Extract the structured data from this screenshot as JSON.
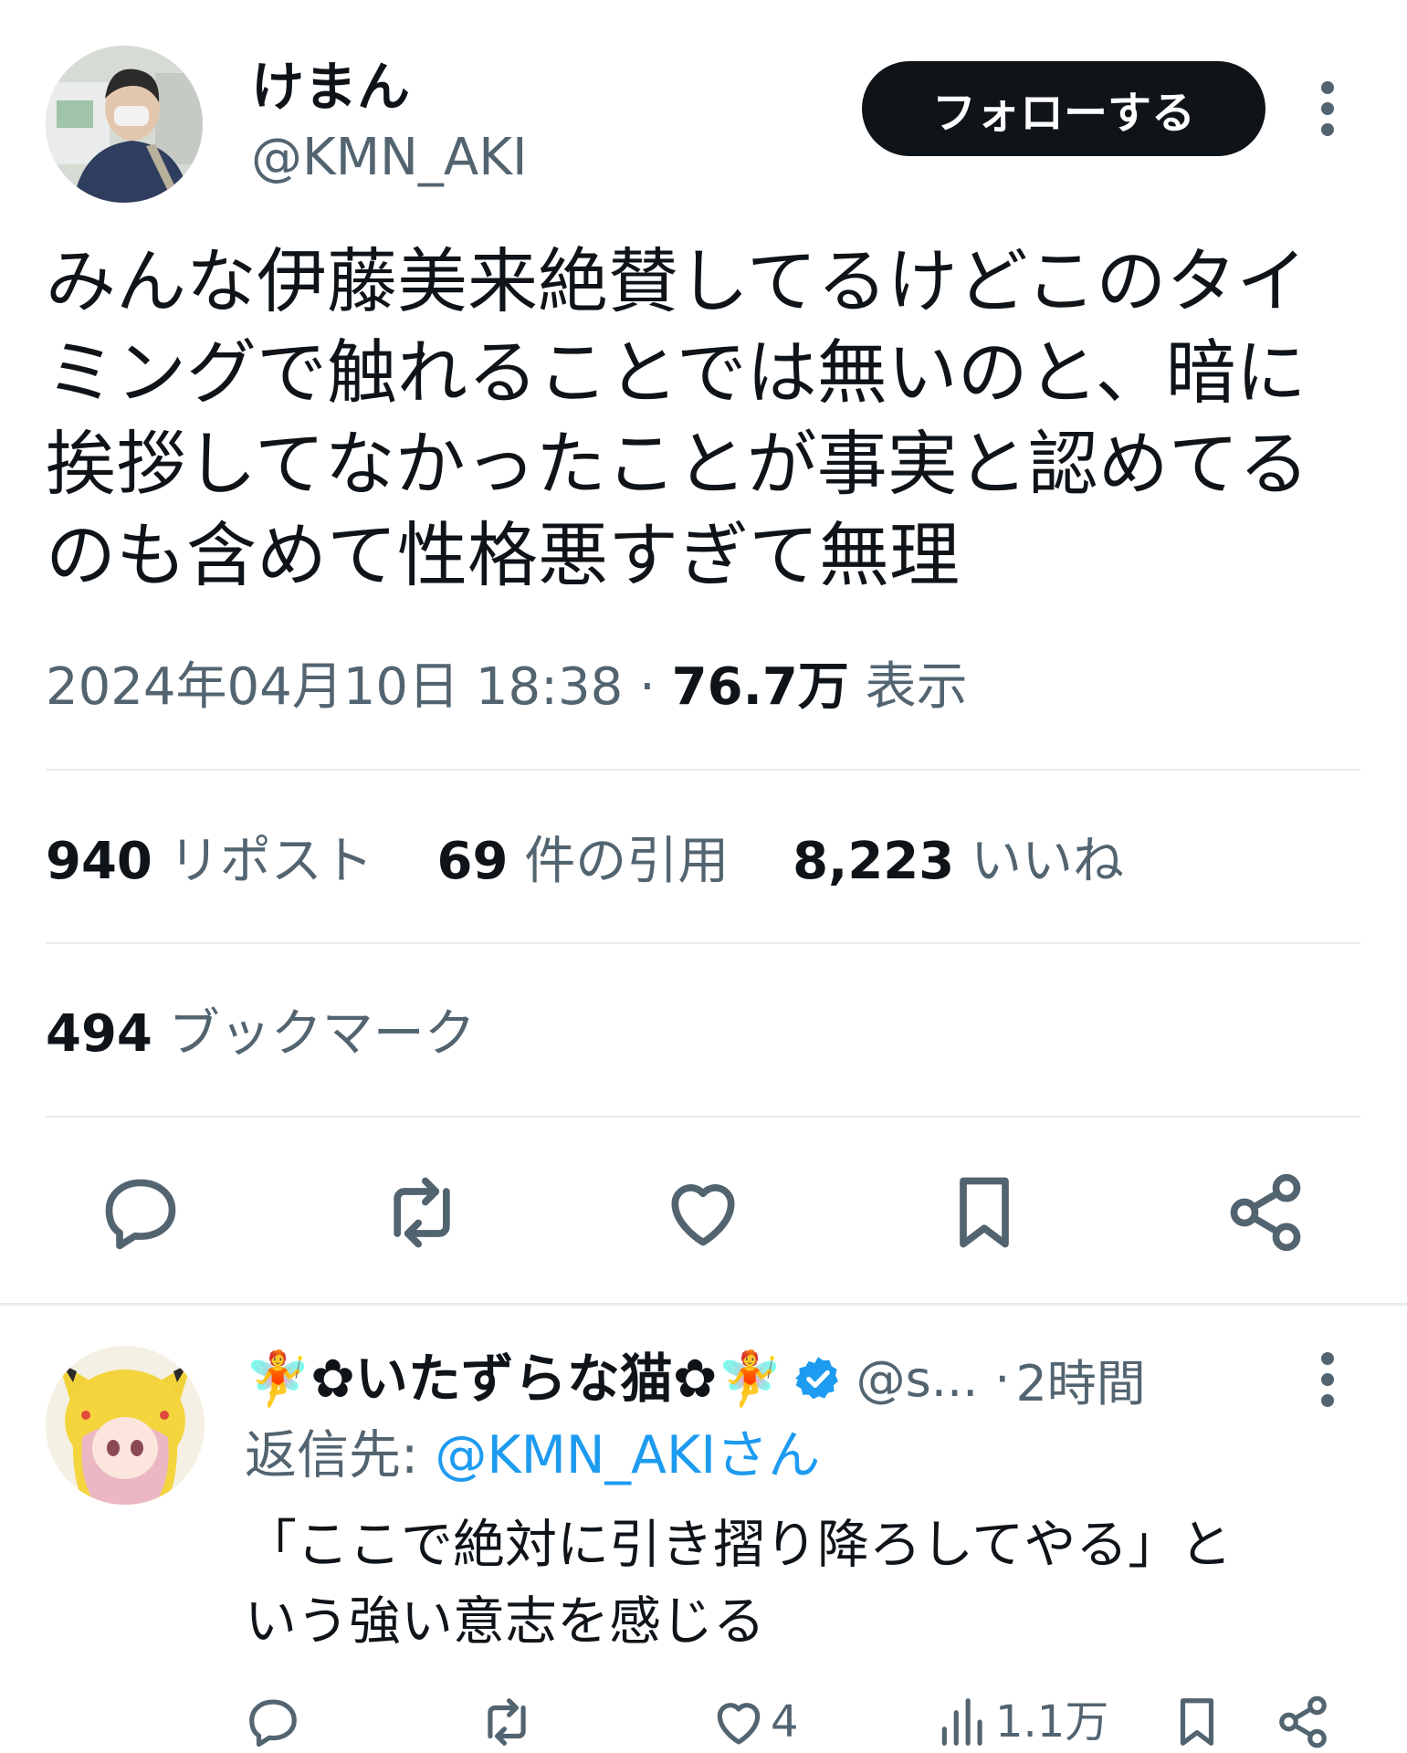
{
  "tweet": {
    "author_name": "けまん",
    "author_handle": "@KMN_AKI",
    "follow_label": "フォローする",
    "text": "みんな伊藤美来絶賛してるけどこのタイ\nミングで触れることでは無いのと、暗に\n挨拶してなかったことが事実と認めてる\nのも含めて性格悪すぎて無理",
    "timestamp": "2024年04月10日 18:38",
    "separator": "·",
    "views_count": "76.7万",
    "views_label": "表示"
  },
  "stats": {
    "reposts_count": "940",
    "reposts_label": "リポスト",
    "quotes_count": "69",
    "quotes_label": "件の引用",
    "likes_count": "8,223",
    "likes_label": "いいね",
    "bookmarks_count": "494",
    "bookmarks_label": "ブックマーク"
  },
  "actions": [
    "reply-icon",
    "repost-icon",
    "like-icon",
    "bookmark-icon",
    "share-icon"
  ],
  "reply": {
    "name": "🧚✿いたずらな猫✿🧚",
    "handle": "@s...",
    "separator": "·",
    "time": "2時間",
    "reply_to_label": "返信先: ",
    "reply_to_mention": "@KMN_AKIさん",
    "text": "「ここで絶対に引き摺り降ろしてやる」と\nいう強い意志を感じる",
    "likes": "4",
    "views": "1.1万"
  },
  "colors": {
    "text": "#0f1419",
    "secondary": "#536471",
    "accent": "#1d9bf0",
    "divider": "#e6ecf0"
  }
}
